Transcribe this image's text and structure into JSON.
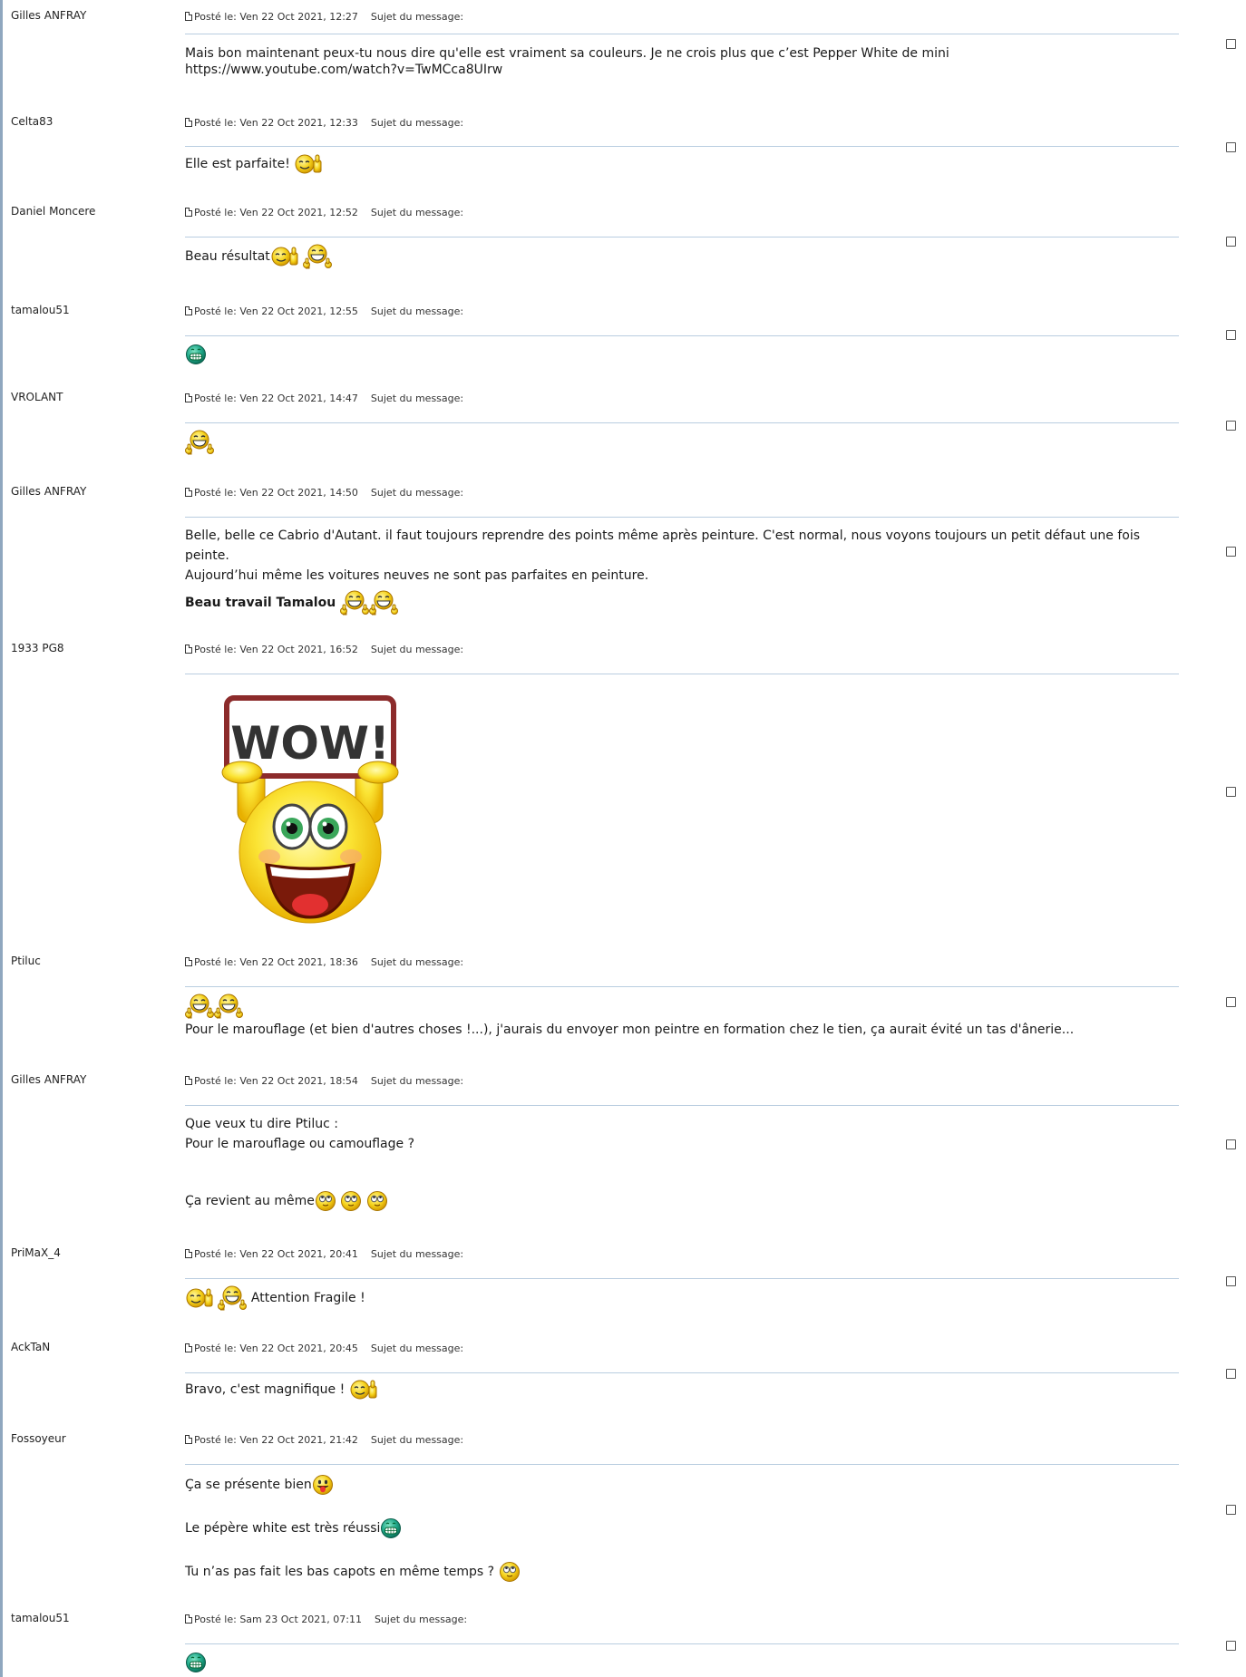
{
  "posts": [
    {
      "author": "Gilles ANFRAY",
      "date": "Ven 22 Oct 2021, 12:27",
      "lines": [
        "Mais bon maintenant peux-tu nous dire qu'elle est vraiment sa couleurs. Je ne crois plus que c’est Pepper White de mini",
        "https://www.youtube.com/watch?v=TwMCca8UIrw"
      ]
    },
    {
      "author": "Celta83",
      "date": "Ven 22 Oct 2021, 12:33",
      "lines": [
        "Elle est parfaite!"
      ]
    },
    {
      "author": "Daniel Moncere",
      "date": "Ven 22 Oct 2021, 12:52",
      "lines": [
        "Beau résultat"
      ]
    },
    {
      "author": "tamalou51",
      "date": "Ven 22 Oct 2021, 12:55",
      "lines": []
    },
    {
      "author": "VROLANT",
      "date": "Ven 22 Oct 2021, 14:47",
      "lines": []
    },
    {
      "author": "Gilles ANFRAY",
      "date": "Ven 22 Oct 2021, 14:50",
      "lines": [
        "Belle, belle ce Cabrio d'Autant. il faut toujours reprendre des points même après peinture. C'est normal, nous voyons toujours un petit défaut une fois peinte.",
        "Aujourd’hui même les voitures neuves ne sont pas parfaites en peinture.",
        "Beau travail Tamalou"
      ]
    },
    {
      "author": "1933 PG8",
      "date": "Ven 22 Oct 2021, 16:52",
      "lines": [],
      "image_text": "WOW!"
    },
    {
      "author": "Ptiluc",
      "date": "Ven 22 Oct 2021, 18:36",
      "lines": [
        "Pour le marouflage (et bien d'autres choses !...), j'aurais du envoyer mon peintre en formation chez le tien, ça aurait évité un tas d'ânerie..."
      ]
    },
    {
      "author": "Gilles ANFRAY",
      "date": "Ven 22 Oct 2021, 18:54",
      "lines": [
        "Que veux tu dire Ptiluc :",
        "Pour le marouflage ou camouflage ?",
        "Ça revient au même"
      ]
    },
    {
      "author": "PriMaX_4",
      "date": "Ven 22 Oct 2021, 20:41",
      "lines": [
        "Attention Fragile !"
      ]
    },
    {
      "author": "AckTaN",
      "date": "Ven 22 Oct 2021, 20:45",
      "lines": [
        "Bravo, c'est magnifique !"
      ]
    },
    {
      "author": "Fossoyeur",
      "date": "Ven 22 Oct 2021, 21:42",
      "lines": [
        "Ça se présente bien",
        "Le pépère white est très réussi",
        "Tu n’as pas fait les bas capots en même temps ?"
      ]
    },
    {
      "author": "tamalou51",
      "date": "Sam 23 Oct 2021, 07:11",
      "lines": []
    }
  ],
  "labels": {
    "posted": "Posté le:",
    "subject": "Sujet du message:"
  },
  "colors": {
    "divider": "#b9cde0",
    "left_border": "#8fa7bf"
  }
}
